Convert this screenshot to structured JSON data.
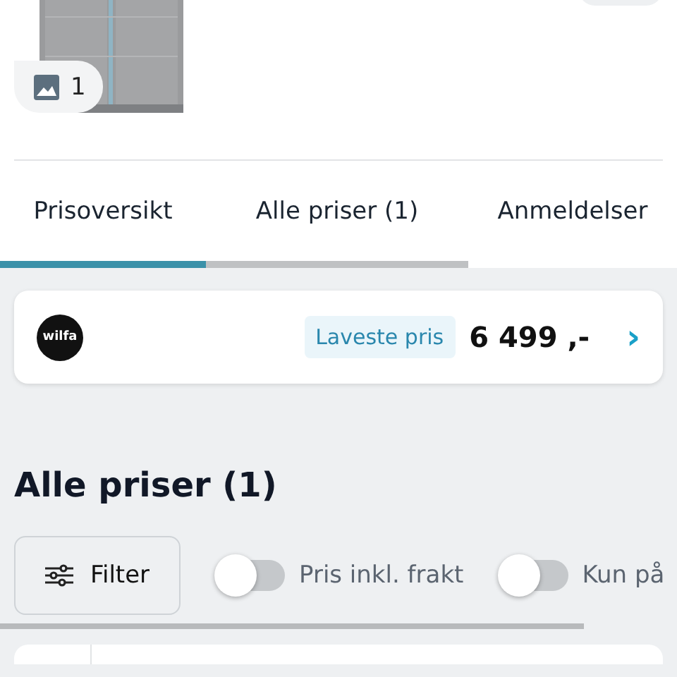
{
  "product": {
    "image_count": "1"
  },
  "tabs": [
    {
      "label": "Prisoversikt",
      "selected": true
    },
    {
      "label": "Alle priser (1)",
      "selected": false
    },
    {
      "label": "Anmeldelser",
      "selected": false
    }
  ],
  "best_offer": {
    "shop_logo": "wilfa",
    "badge": "Laveste pris",
    "price": "6 499 ,-",
    "chevron": "›"
  },
  "all_prices": {
    "heading": "Alle priser (1)",
    "filter_button": "Filter",
    "toggles": [
      {
        "label": "Pris inkl. frakt",
        "on": false
      },
      {
        "label": "Kun på",
        "on": false
      }
    ]
  }
}
